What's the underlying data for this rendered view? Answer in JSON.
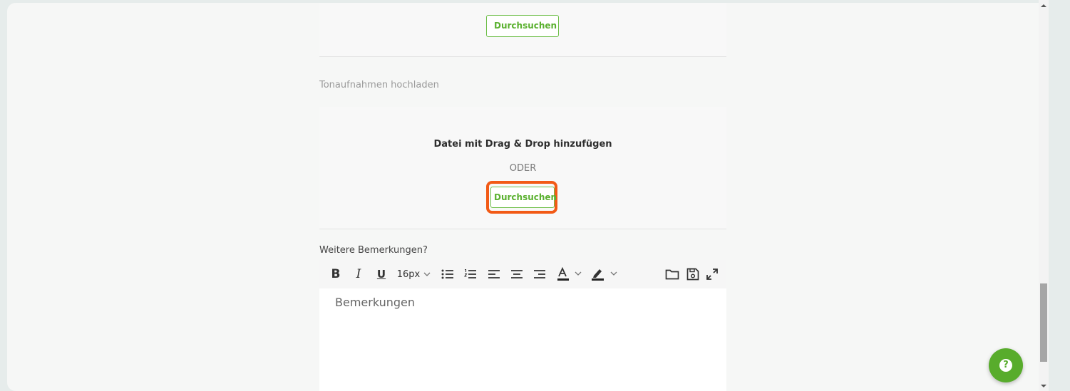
{
  "upload_top": {
    "browse_label": "Durchsuchen"
  },
  "audio": {
    "label": "Tonaufnahmen hochladen",
    "dropzone_title": "Datei mit Drag & Drop hinzufügen",
    "or_label": "ODER",
    "browse_label": "Durchsuchen"
  },
  "remarks": {
    "label": "Weitere Bemerkungen?",
    "placeholder": "Bemerkungen",
    "toolbar": {
      "bold": "B",
      "italic": "I",
      "underline": "U",
      "font_size": "16px",
      "icons": [
        "bold-icon",
        "italic-icon",
        "underline-icon",
        "bullet-list-icon",
        "numbered-list-icon",
        "align-left-icon",
        "align-center-icon",
        "align-right-icon",
        "text-color-icon",
        "highlight-color-icon",
        "folder-open-icon",
        "save-icon",
        "fullscreen-icon"
      ]
    }
  },
  "colors": {
    "accent": "#5bb130",
    "highlight": "#f25a16",
    "fab": "#58ac2c"
  }
}
